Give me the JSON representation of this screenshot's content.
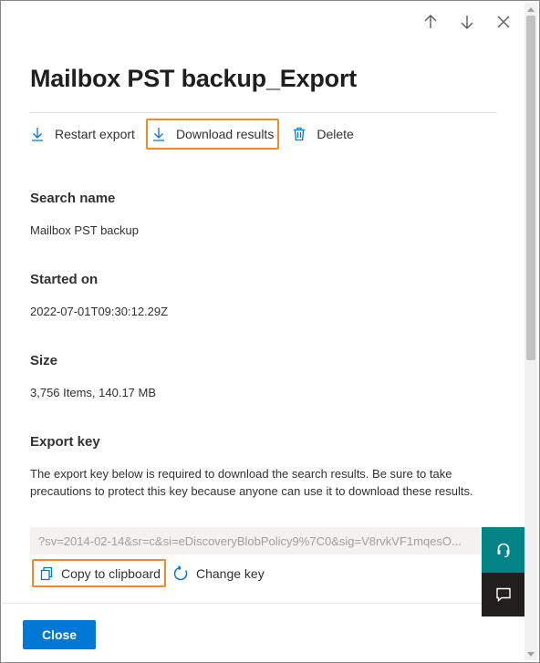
{
  "panel": {
    "title": "Mailbox PST backup_Export"
  },
  "nav": {
    "up_icon": "arrow-up-icon",
    "down_icon": "arrow-down-icon",
    "close_icon": "close-icon"
  },
  "toolbar": {
    "restart_label": "Restart export",
    "download_label": "Download results",
    "delete_label": "Delete"
  },
  "details": {
    "search_name_label": "Search name",
    "search_name_value": "Mailbox PST backup",
    "started_on_label": "Started on",
    "started_on_value": "2022-07-01T09:30:12.29Z",
    "size_label": "Size",
    "size_value": "3,756 Items, 140.17 MB",
    "export_key_label": "Export key",
    "export_key_description": "The export key below is required to download the search results. Be sure to take precautions to protect this key because anyone can use it to download these results.",
    "export_key_value": "?sv=2014-02-14&sr=c&si=eDiscoveryBlobPolicy9%7C0&sig=V8rvkVF1mqesO..."
  },
  "key_actions": {
    "copy_label": "Copy to clipboard",
    "change_label": "Change key"
  },
  "footer": {
    "close_label": "Close"
  },
  "colors": {
    "accent": "#0078d4",
    "highlight": "#f28a28",
    "help_button": "#038387",
    "feedback_button": "#201f1e"
  }
}
